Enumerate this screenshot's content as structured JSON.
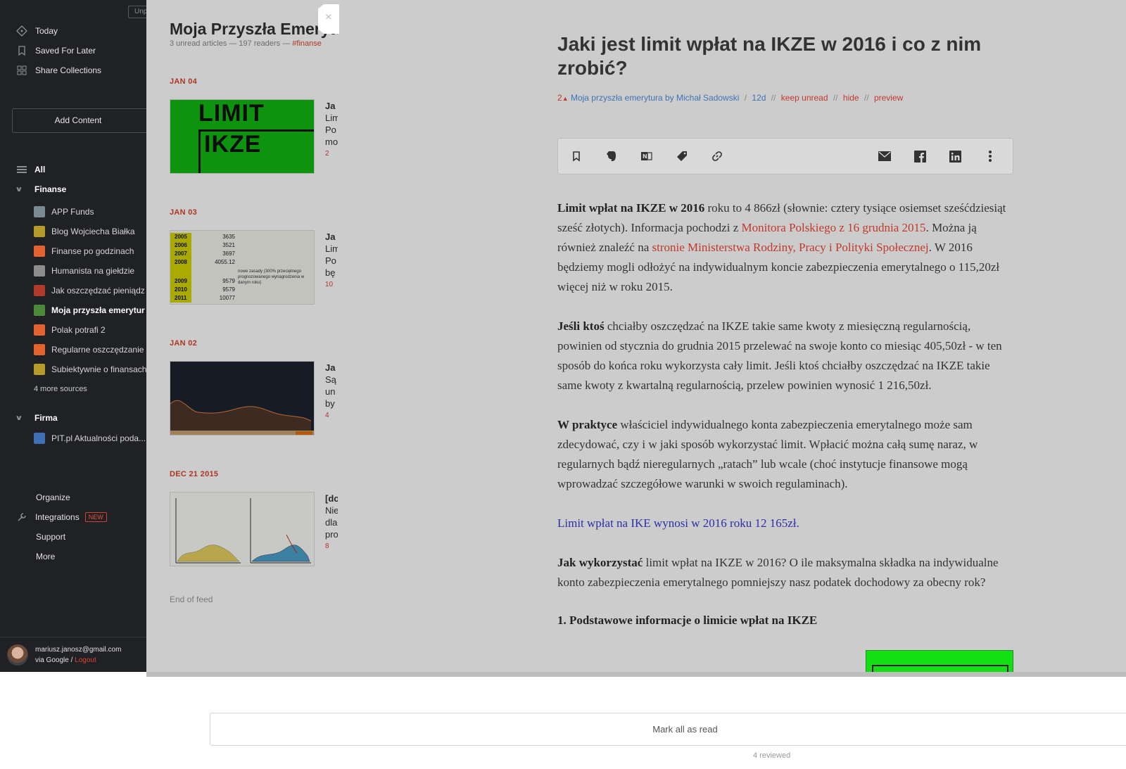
{
  "sidebar": {
    "unpin": "Unp",
    "nav_top": [
      {
        "label": "Today",
        "icon": "today-icon"
      },
      {
        "label": "Saved For Later",
        "icon": "bookmark-icon"
      },
      {
        "label": "Share Collections",
        "icon": "collections-icon"
      }
    ],
    "add_content": "Add Content",
    "all_label": "All",
    "group_finanse": "Finanse",
    "finanse_feeds": [
      {
        "label": "APP Funds",
        "color": "#7c8a94"
      },
      {
        "label": "Blog Wojciecha Białka",
        "color": "#b59b2a"
      },
      {
        "label": "Finanse po godzinach",
        "color": "#e2632d"
      },
      {
        "label": "Humanista na giełdzie",
        "color": "#8d8d8d"
      },
      {
        "label": "Jak oszczędzać pieniądz",
        "color": "#b23a2a"
      },
      {
        "label": "Moja przyszła emerytur",
        "color": "#4a8a3a",
        "active": true
      },
      {
        "label": "Polak potrafi 2",
        "color": "#e2632d"
      },
      {
        "label": "Regularne oszczędzanie",
        "color": "#e2632d"
      },
      {
        "label": "Subiektywnie o finansach",
        "color": "#b59b2a"
      }
    ],
    "more_sources": "4 more sources",
    "group_firma": "Firma",
    "firma_feeds": [
      {
        "label": "PIT.pl Aktualności poda...",
        "color": "#3f6fb5"
      }
    ],
    "bottom_nav": {
      "organize": "Organize",
      "integrations": "Integrations",
      "new_badge": "NEW",
      "support": "Support",
      "more": "More"
    },
    "account": {
      "email": "mariusz.janosz@gmail.com",
      "via": "via Google /",
      "logout": "Logout"
    }
  },
  "feed": {
    "title": "Moja Przyszła Emerytura",
    "meta": "3 unread articles — 197 readers —",
    "meta_tag": "#finanse",
    "items": [
      {
        "date": "JAN 04",
        "title": "Ja",
        "l1": "Lim",
        "l2": "Po",
        "l3": "mo",
        "count": "2"
      },
      {
        "date": "JAN 03",
        "title": "Ja",
        "l1": "Lim",
        "l2": "Po",
        "l3": "bę",
        "count": "10"
      },
      {
        "date": "JAN 02",
        "title": "Ja",
        "l1": "Są",
        "l2": "un",
        "l3": "by",
        "count": "4"
      },
      {
        "date": "DEC 21 2015",
        "title": "[do",
        "l1": "Nie",
        "l2": "dla",
        "l3": "pro",
        "count": "8"
      }
    ],
    "thumb1_text": [
      "LIMIT",
      "IKZE"
    ],
    "thumb2_rows": [
      [
        "2005",
        "3635"
      ],
      [
        "2006",
        "3521"
      ],
      [
        "2007",
        "3697"
      ],
      [
        "2008",
        "4055.12"
      ],
      [
        "2009",
        "9579"
      ],
      [
        "2010",
        "9579"
      ],
      [
        "2011",
        "10077"
      ]
    ],
    "thumb2_note": "nowe zasady (300% przeciętnego prognozowanego wynagrodzenia w danym roku)",
    "end_of_feed": "End of feed"
  },
  "article": {
    "title": "Jaki jest limit wpłat na IKZE w 2016 i co z nim zrobić?",
    "meta": {
      "count": "2",
      "source": "Moja przyszła emerytura by Michał Sadowski",
      "age": "12d",
      "keep_unread": "keep unread",
      "hide": "hide",
      "preview": "preview",
      "sep1": "/",
      "sep2": "//"
    },
    "p1_bold": "Limit wpłat na IKZE w 2016",
    "p1_a": " roku to 4 866zł (słownie: cztery tysiące osiemset sześćdziesiąt sześć złotych). Informacja pochodzi z ",
    "p1_link1": "Monitora Polskiego z 16 grudnia 2015",
    "p1_b": ". Można ją również znaleźć na ",
    "p1_link2": "stronie Ministerstwa Rodziny, Pracy i Polityki Społecznej",
    "p1_c": ". W 2016 będziemy mogli odłożyć na indywidualnym koncie zabezpieczenia emerytalnego o 115,20zł więcej niż w roku 2015.",
    "p2_bold": "Jeśli ktoś",
    "p2_a": " chciałby oszczędzać na IKZE takie same kwoty z miesięczną regularnością, powinien od stycznia do grudnia 2015 przelewać na swoje konto co miesiąc 405,50zł - w ten sposób do końca roku wykorzysta cały limit. Jeśli ktoś chciałby oszczędzać na IKZE takie same kwoty z kwartalną regularnością, przelew powinien wynosić 1 216,50zł.",
    "p3_bold": "W praktyce",
    "p3_a": " właściciel indywidualnego konta zabezpieczenia emerytalnego może sam zdecydować, czy i w jaki sposób wykorzystać limit. Wpłacić można całą sumę naraz, w regularnych bądź nieregularnych „ratach” lub wcale (choć instytucje finansowe mogą wprowadzać szczegółowe warunki w swoich regulaminach).",
    "p4_link": "Limit wpłat na IKE wynosi w 2016 roku 12 165zł.",
    "p5_bold": "Jak wykorzystać",
    "p5_a": " limit wpłat na IKZE w 2016? O ile maksymalna składka na indywidualne konto zabezpieczenia emerytalnego pomniejszy nasz podatek dochodowy za obecny rok?",
    "h_section": "1. Podstawowe informacje o limicie wpłat na IKZE",
    "close": "×"
  },
  "footer": {
    "mark_all": "Mark all as read",
    "reviewed": "4 reviewed"
  }
}
